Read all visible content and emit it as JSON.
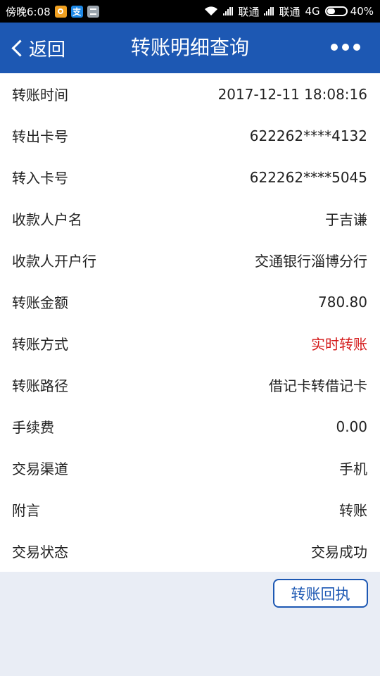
{
  "status_bar": {
    "time": "傍晚6:08",
    "notif_app_text": "支",
    "carrier1": "联通",
    "carrier2": "联通",
    "network": "4G",
    "battery": "40%"
  },
  "nav": {
    "back_label": "返回",
    "title": "转账明细查询"
  },
  "details": [
    {
      "label": "转账时间",
      "value": "2017-12-11 18:08:16"
    },
    {
      "label": "转出卡号",
      "value": "622262****4132"
    },
    {
      "label": "转入卡号",
      "value": "622262****5045"
    },
    {
      "label": "收款人户名",
      "value": "于吉谦"
    },
    {
      "label": "收款人开户行",
      "value": "交通银行淄博分行"
    },
    {
      "label": "转账金额",
      "value": "780.80"
    },
    {
      "label": "转账方式",
      "value": "实时转账",
      "value_color": "#d41a1a"
    },
    {
      "label": "转账路径",
      "value": "借记卡转借记卡"
    },
    {
      "label": "手续费",
      "value": "0.00"
    },
    {
      "label": "交易渠道",
      "value": "手机"
    },
    {
      "label": "附言",
      "value": "转账"
    },
    {
      "label": "交易状态",
      "value": "交易成功"
    }
  ],
  "receipt_button_label": "转账回执",
  "colors": {
    "nav_background": "#1d58b3",
    "page_background": "#e9edf5",
    "highlight_value": "#d41a1a"
  }
}
